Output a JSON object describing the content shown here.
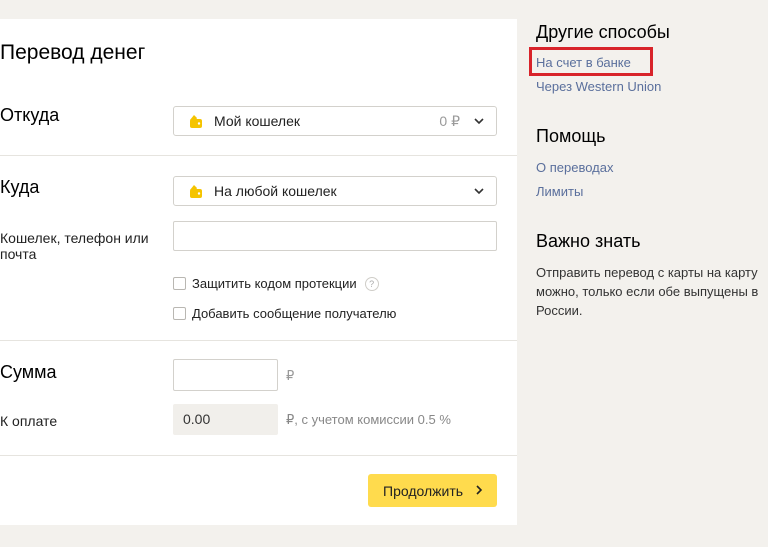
{
  "main": {
    "title": "Перевод денег",
    "from": {
      "label": "Откуда",
      "value": "Мой кошелек",
      "amount": "0 ₽"
    },
    "to": {
      "label": "Куда",
      "value": "На любой кошелек"
    },
    "recipient": {
      "label": "Кошелек, телефон или почта",
      "value": ""
    },
    "protect_label": "Защитить кодом протекции",
    "help_symbol": "?",
    "message_label": "Добавить сообщение получателю",
    "sum": {
      "label": "Сумма",
      "value": "",
      "currency": "₽"
    },
    "pay": {
      "label": "К оплате",
      "value": "0.00",
      "commission": "₽, с учетом комиссии 0.5 %"
    },
    "continue_label": "Продолжить"
  },
  "sidebar": {
    "other_title": "Другие способы",
    "other_links": [
      "На счет в банке",
      "Через Western Union"
    ],
    "help_title": "Помощь",
    "help_links": [
      "О переводах",
      "Лимиты"
    ],
    "important_title": "Важно знать",
    "important_text": "Отправить перевод с карты на карту\nможно, только если обе выпущены в\nРоссии."
  },
  "colors": {
    "accent_button": "#ffdb4d",
    "link": "#5a6f9c",
    "highlight_box": "#d8232a",
    "wallet_icon": "#f5c400"
  }
}
